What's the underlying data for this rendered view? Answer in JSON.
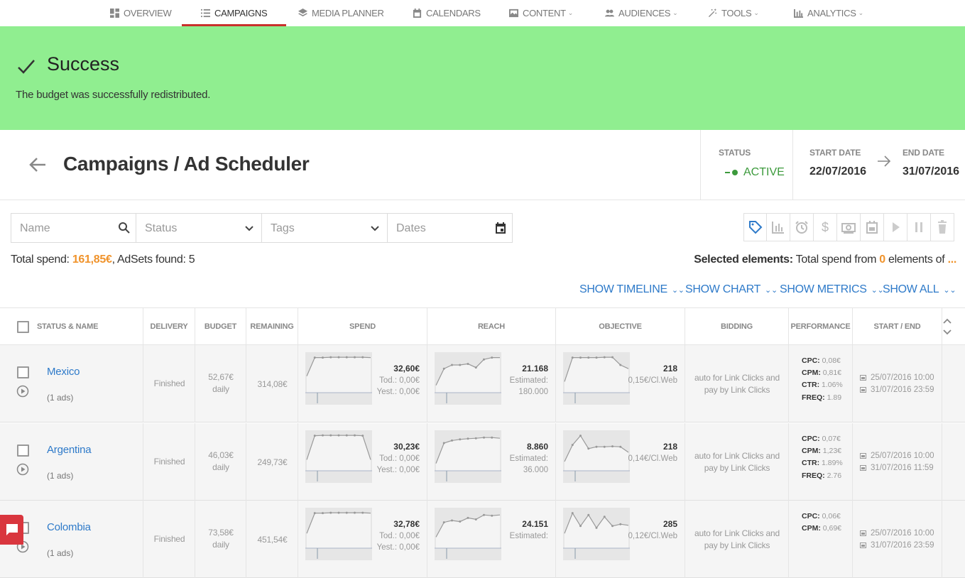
{
  "nav": {
    "items": [
      {
        "label": "OVERVIEW",
        "icon": "dashboard-icon",
        "dropdown": false
      },
      {
        "label": "CAMPAIGNS",
        "icon": "list-icon",
        "dropdown": false,
        "active": true
      },
      {
        "label": "MEDIA PLANNER",
        "icon": "layers-icon",
        "dropdown": false
      },
      {
        "label": "CALENDARS",
        "icon": "calendar-icon",
        "dropdown": false
      },
      {
        "label": "CONTENT",
        "icon": "image-icon",
        "dropdown": true
      },
      {
        "label": "AUDIENCES",
        "icon": "people-icon",
        "dropdown": true
      },
      {
        "label": "TOOLS",
        "icon": "magic-wand-icon",
        "dropdown": true
      },
      {
        "label": "ANALYTICS",
        "icon": "bar-chart-icon",
        "dropdown": true
      }
    ]
  },
  "banner": {
    "title": "Success",
    "message": "The budget was successfully redistributed.",
    "color": "#90ee90"
  },
  "header": {
    "title": "Campaigns / Ad Scheduler",
    "status_label": "STATUS",
    "status_value": "ACTIVE",
    "start_label": "START DATE",
    "start_value": "22/07/2016",
    "end_label": "END DATE",
    "end_value": "31/07/2016"
  },
  "filters": {
    "name_placeholder": "Name",
    "status_placeholder": "Status",
    "tags_placeholder": "Tags",
    "dates_placeholder": "Dates"
  },
  "toolbar": [
    "tag-icon",
    "bar-chart-icon",
    "alarm-icon",
    "dollar-icon",
    "money-icon",
    "calendar-icon",
    "play-icon",
    "pause-icon",
    "trash-icon"
  ],
  "summary": {
    "total_label": "Total spend: ",
    "total_value": "161,85€",
    "adsets_label": ", AdSets found: ",
    "adsets_value": "5",
    "selected_label": "Selected elements:",
    "selected_text_a": " Total spend from ",
    "selected_count": "0",
    "selected_text_b": " elements of ",
    "selected_more": "..."
  },
  "show_links": [
    "SHOW TIMELINE",
    "SHOW CHART",
    "SHOW METRICS",
    "SHOW ALL"
  ],
  "table": {
    "headers": [
      "STATUS & NAME",
      "DELIVERY",
      "BUDGET",
      "REMAINING",
      "SPEND",
      "REACH",
      "OBJECTIVE",
      "BIDDING",
      "PERFORMANCE",
      "START / END"
    ],
    "rows": [
      {
        "name": "Mexico",
        "ads": "(1 ads)",
        "delivery": "Finished",
        "budget": "52,67€",
        "budget_period": "daily",
        "remaining": "314,08€",
        "spend": "32,60€",
        "spend_tod": "Tod.: 0,00€",
        "spend_yest": "Yest.: 0,00€",
        "reach": "21.168",
        "reach_est_label": "Estimated:",
        "reach_est": "180.000",
        "objective": "218",
        "objective_rate": "0,15€/Cl.Web",
        "bidding": "auto for Link Clicks and pay by Link Clicks",
        "cpc": "0,08€",
        "cpm": "0,81€",
        "ctr": "1.06%",
        "freq": "1.89",
        "start": "25/07/2016 10:00",
        "end": "31/07/2016 23:59",
        "spend_series": [
          0.45,
          0.95,
          0.95,
          0.96,
          0.96,
          0.96,
          0.96,
          0.96,
          0.95
        ],
        "reach_series": [
          0.2,
          0.65,
          0.75,
          0.75,
          0.78,
          0.68,
          0.9,
          0.95,
          0.95
        ],
        "objective_series": [
          0.3,
          0.95,
          0.95,
          0.95,
          0.95,
          0.96,
          0.96,
          0.75,
          0.65
        ]
      },
      {
        "name": "Argentina",
        "ads": "(1 ads)",
        "delivery": "Finished",
        "budget": "46,03€",
        "budget_period": "daily",
        "remaining": "249,73€",
        "spend": "30,23€",
        "spend_tod": "Tod.: 0,00€",
        "spend_yest": "Yest.: 0,00€",
        "reach": "8.860",
        "reach_est_label": "Estimated:",
        "reach_est": "36.000",
        "objective": "218",
        "objective_rate": "0,14€/Cl.Web",
        "bidding": "auto for Link Clicks and pay by Link Clicks",
        "cpc": "0,07€",
        "cpm": "1,23€",
        "ctr": "1.89%",
        "freq": "2.76",
        "start": "25/07/2016 10:00",
        "end": "31/07/2016 11:59",
        "spend_series": [
          0.3,
          0.95,
          0.96,
          0.96,
          0.96,
          0.96,
          0.96,
          0.95,
          0.3
        ],
        "reach_series": [
          0.2,
          0.75,
          0.82,
          0.85,
          0.87,
          0.88,
          0.9,
          0.9,
          0.88
        ],
        "objective_series": [
          0.25,
          0.7,
          0.95,
          0.6,
          0.65,
          0.65,
          0.66,
          0.65,
          0.5
        ]
      },
      {
        "name": "Colombia",
        "ads": "(1 ads)",
        "delivery": "Finished",
        "budget": "73,58€",
        "budget_period": "daily",
        "remaining": "451,54€",
        "spend": "32,78€",
        "spend_tod": "Tod.: 0,00€",
        "spend_yest": "Yest.: 0,00€",
        "reach": "24.151",
        "reach_est_label": "Estimated:",
        "reach_est": "",
        "objective": "285",
        "objective_rate": "0,12€/Cl.Web",
        "bidding": "auto for Link Clicks and pay by Link Clicks",
        "cpc": "0,06€",
        "cpm": "0,69€",
        "ctr": "",
        "freq": "",
        "start": "25/07/2016 10:00",
        "end": "31/07/2016 23:59",
        "spend_series": [
          0.4,
          0.95,
          0.95,
          0.96,
          0.96,
          0.96,
          0.96,
          0.96,
          0.95
        ],
        "reach_series": [
          0.3,
          0.7,
          0.75,
          0.72,
          0.82,
          0.78,
          0.9,
          0.88,
          0.9
        ],
        "objective_series": [
          0.4,
          0.95,
          0.6,
          0.9,
          0.55,
          0.85,
          0.6,
          0.65,
          0.62
        ]
      }
    ]
  }
}
